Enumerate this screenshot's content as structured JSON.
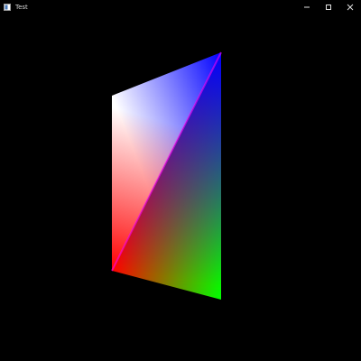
{
  "window": {
    "title": "Test",
    "icon": "app-window-icon",
    "controls": {
      "minimize": "minimize-icon",
      "maximize": "maximize-icon",
      "close": "close-icon"
    }
  },
  "scene": {
    "background": "#000000",
    "vertex_colors": {
      "top_left": "#ffffff",
      "top_right": "#0000ff",
      "bottom_left": "#ff0000",
      "bottom_right": "#00ff00"
    }
  }
}
